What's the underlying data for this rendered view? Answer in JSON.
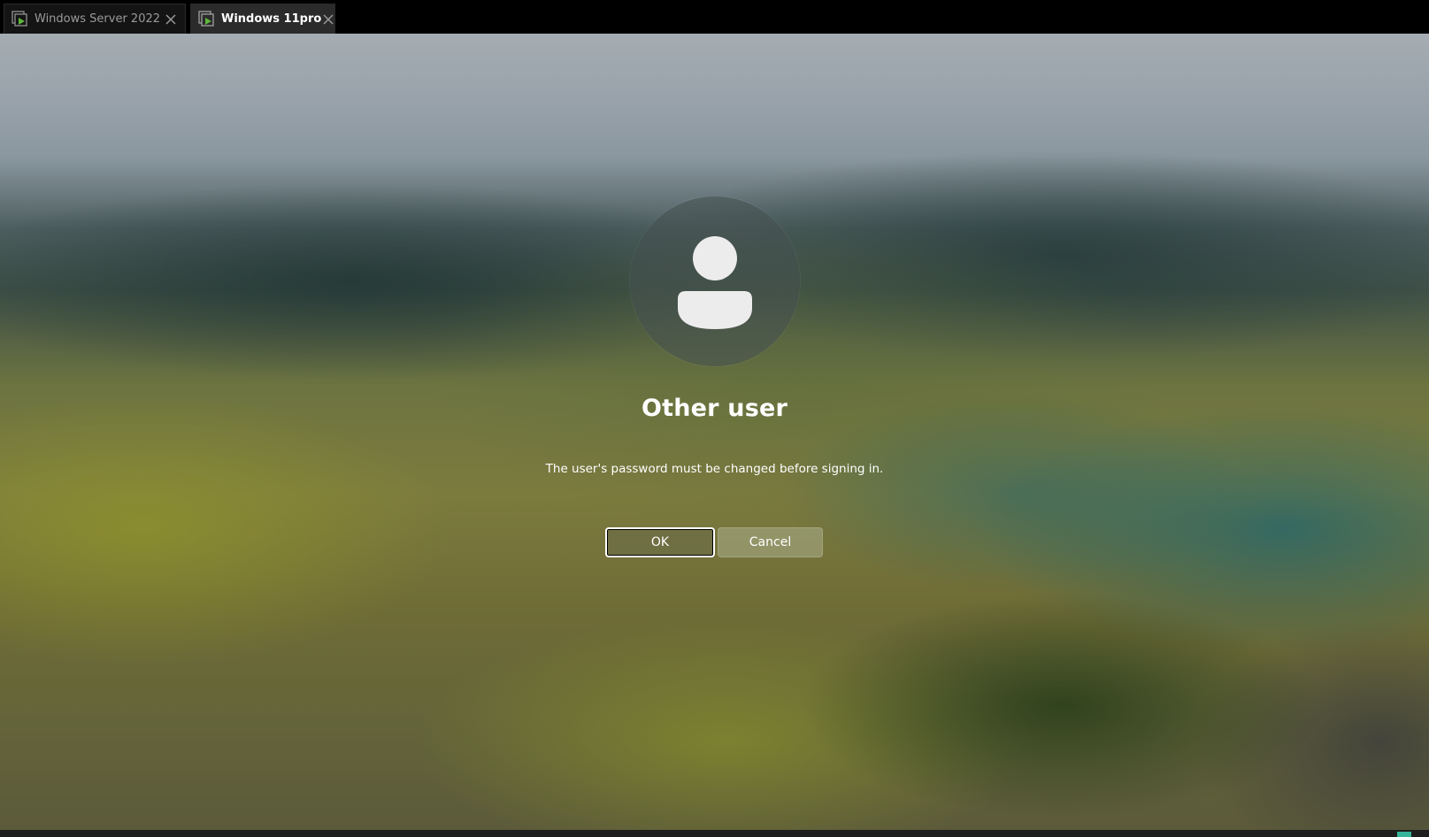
{
  "tabs": [
    {
      "label": "Windows Server 2022",
      "active": false
    },
    {
      "label": "Windows 11pro",
      "active": true
    }
  ],
  "signin": {
    "user_name": "Other user",
    "message": "The user's password must be changed before signing in.",
    "ok_label": "OK",
    "cancel_label": "Cancel"
  },
  "colors": {
    "vm_icon_green": "#5fb63a",
    "tray_accent": "#36b59a"
  }
}
